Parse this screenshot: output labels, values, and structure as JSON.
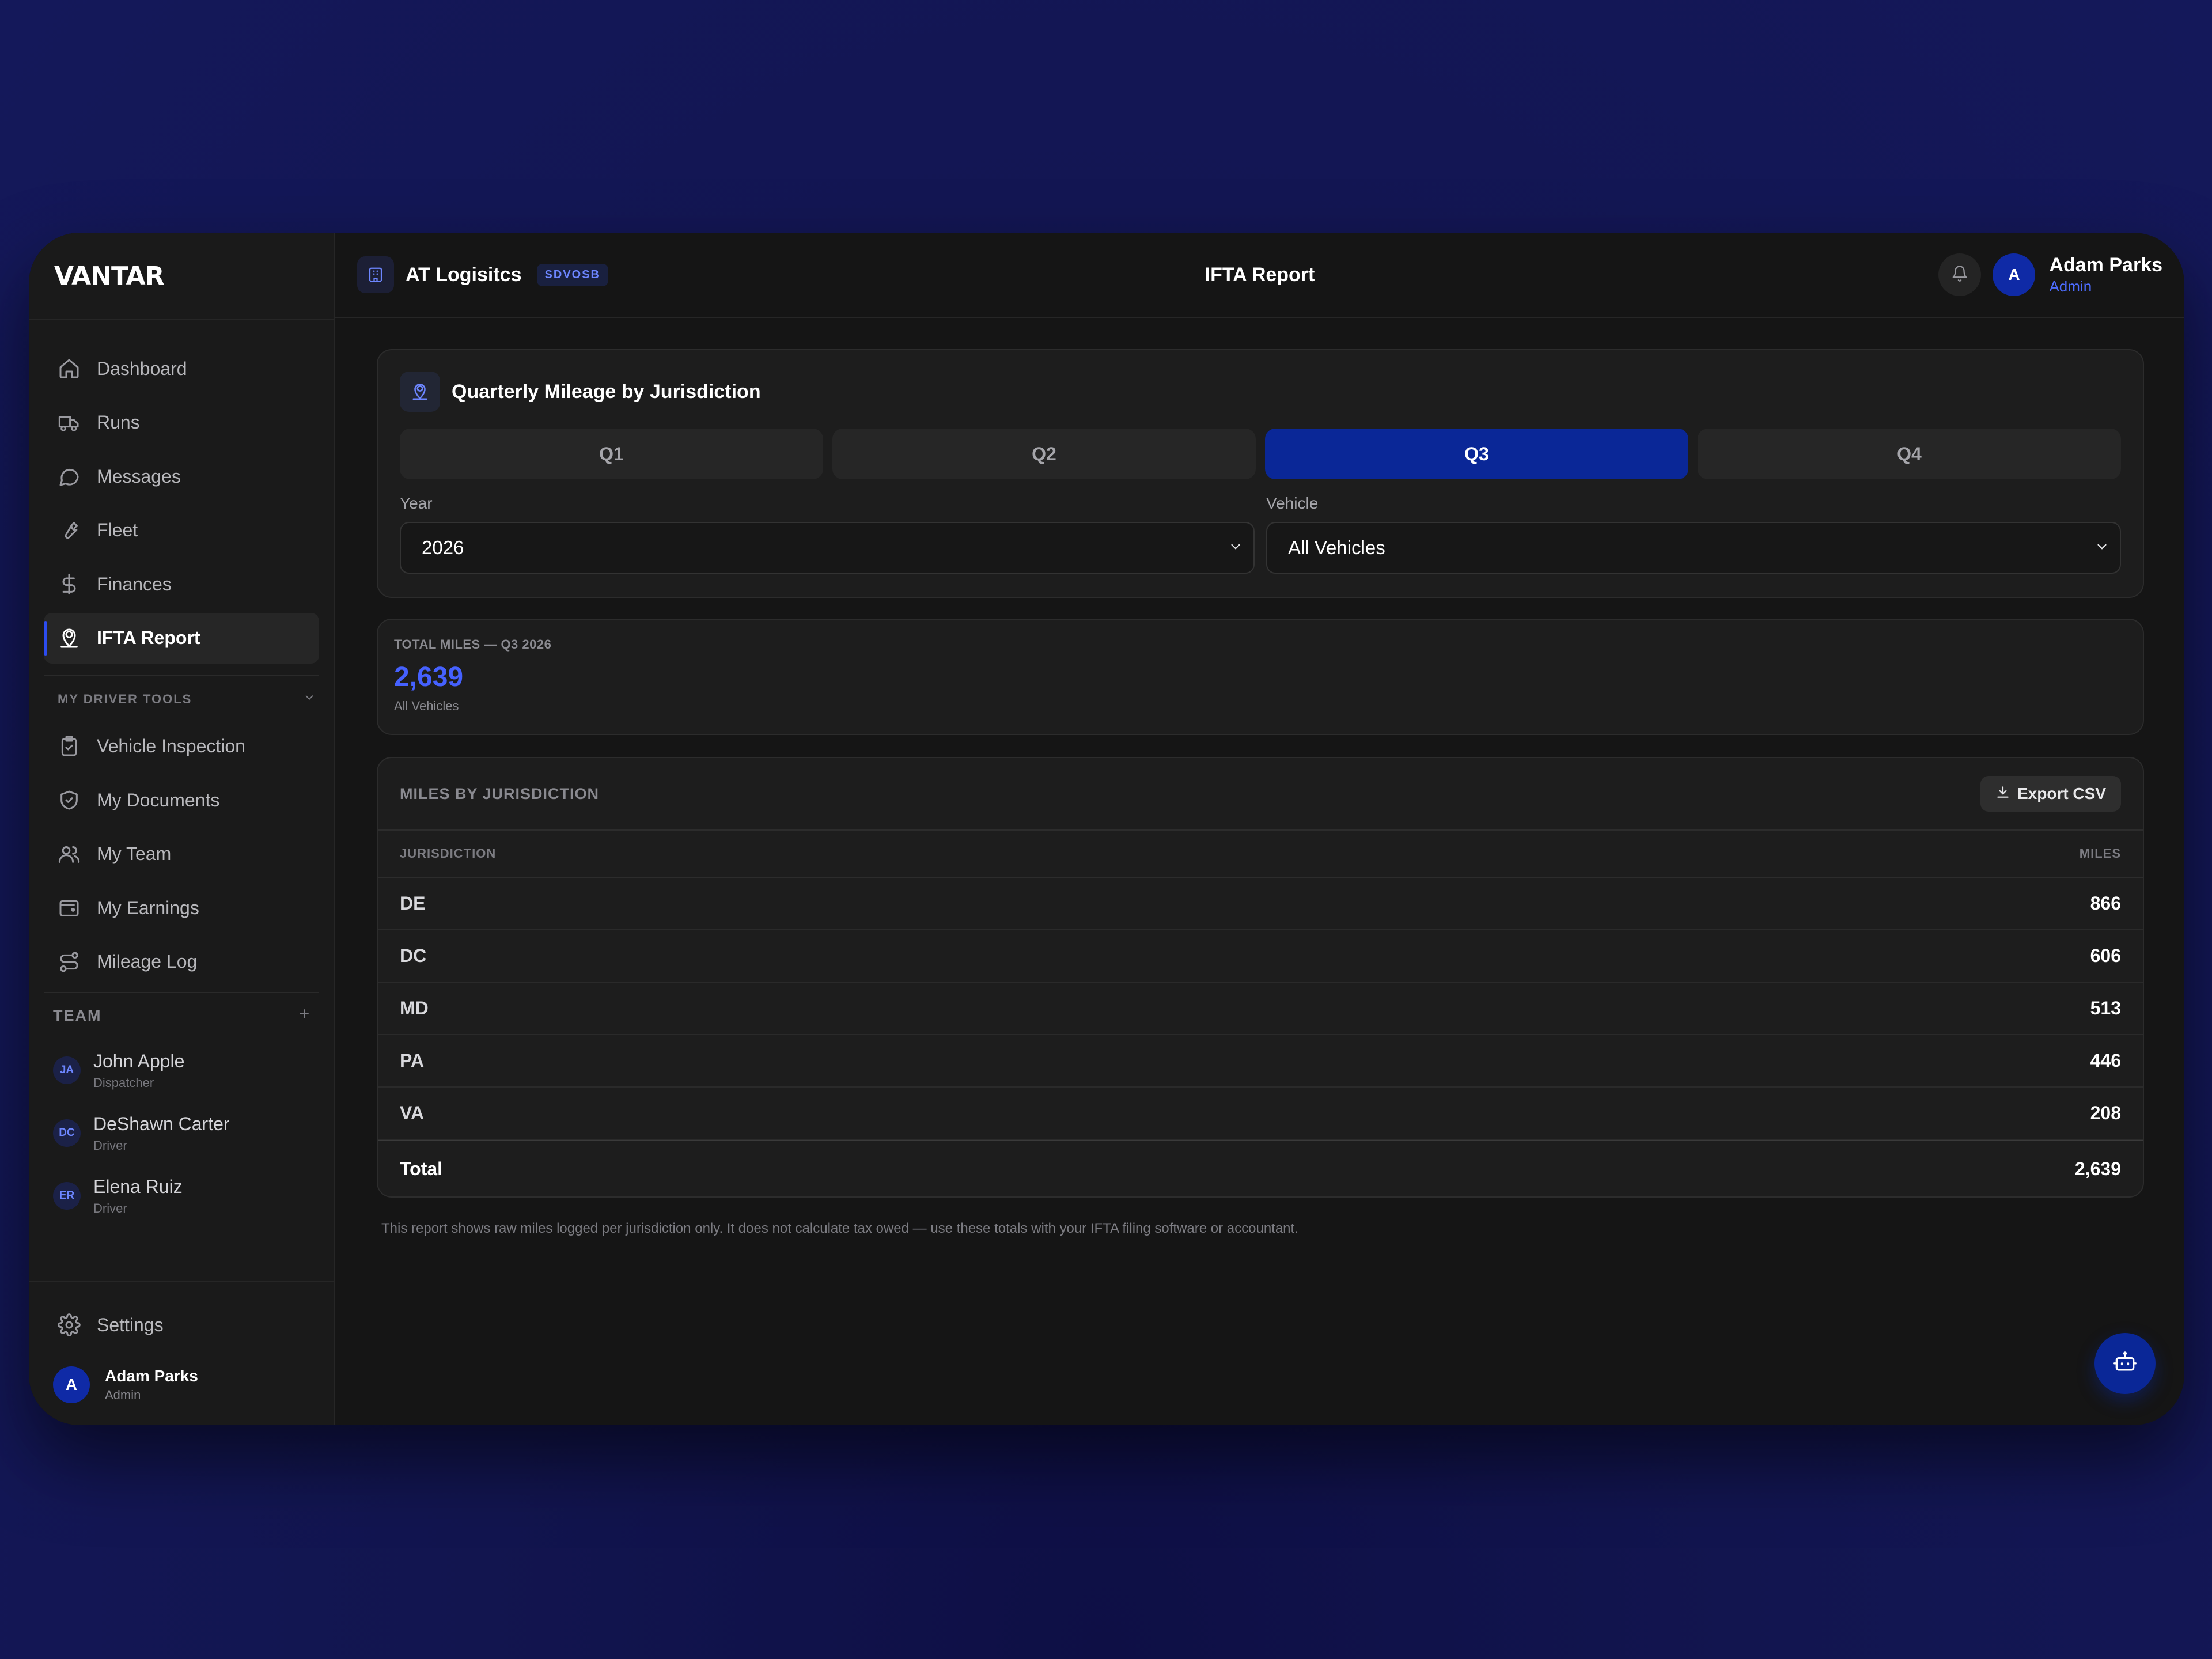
{
  "app": {
    "logo": "VANTAR"
  },
  "sidebar": {
    "nav": [
      {
        "label": "Dashboard",
        "icon": "home-icon"
      },
      {
        "label": "Runs",
        "icon": "truck-icon"
      },
      {
        "label": "Messages",
        "icon": "message-icon"
      },
      {
        "label": "Fleet",
        "icon": "wrench-icon"
      },
      {
        "label": "Finances",
        "icon": "dollar-icon"
      },
      {
        "label": "IFTA Report",
        "icon": "map-pin-user-icon",
        "active": true
      }
    ],
    "driver_tools_label": "MY DRIVER TOOLS",
    "driver_tools": [
      {
        "label": "Vehicle Inspection",
        "icon": "clipboard-check-icon"
      },
      {
        "label": "My Documents",
        "icon": "shield-check-icon"
      },
      {
        "label": "My Team",
        "icon": "users-icon"
      },
      {
        "label": "My Earnings",
        "icon": "wallet-icon"
      },
      {
        "label": "Mileage Log",
        "icon": "route-icon"
      }
    ],
    "team_label": "TEAM",
    "team": [
      {
        "initials": "JA",
        "name": "John Apple",
        "role": "Dispatcher"
      },
      {
        "initials": "DC",
        "name": "DeShawn Carter",
        "role": "Driver"
      },
      {
        "initials": "ER",
        "name": "Elena Ruiz",
        "role": "Driver"
      }
    ],
    "settings_label": "Settings",
    "user": {
      "initial": "A",
      "name": "Adam Parks",
      "role": "Admin"
    }
  },
  "header": {
    "org_name": "AT Logisitcs",
    "org_badge": "SDVOSB",
    "title": "IFTA Report",
    "user": {
      "initial": "A",
      "name": "Adam Parks",
      "role": "Admin"
    }
  },
  "quarter_card": {
    "title": "Quarterly Mileage by Jurisdiction",
    "tabs": [
      "Q1",
      "Q2",
      "Q3",
      "Q4"
    ],
    "active_tab": "Q3",
    "year_label": "Year",
    "year_value": "2026",
    "vehicle_label": "Vehicle",
    "vehicle_value": "All Vehicles"
  },
  "total": {
    "label": "TOTAL MILES — Q3 2026",
    "value": "2,639",
    "sub": "All Vehicles"
  },
  "table": {
    "title": "MILES BY JURISDICTION",
    "export_label": "Export CSV",
    "col_jurisdiction": "JURISDICTION",
    "col_miles": "MILES",
    "rows": [
      {
        "jurisdiction": "DE",
        "miles": "866"
      },
      {
        "jurisdiction": "DC",
        "miles": "606"
      },
      {
        "jurisdiction": "MD",
        "miles": "513"
      },
      {
        "jurisdiction": "PA",
        "miles": "446"
      },
      {
        "jurisdiction": "VA",
        "miles": "208"
      }
    ],
    "total_label": "Total",
    "total_value": "2,639"
  },
  "footnote": "This report shows raw miles logged per jurisdiction only. It does not calculate tax owed — use these totals with your IFTA filing software or accountant.",
  "colors": {
    "accent": "#0a2797",
    "accent_text": "#4561ff",
    "background": "#151515"
  }
}
